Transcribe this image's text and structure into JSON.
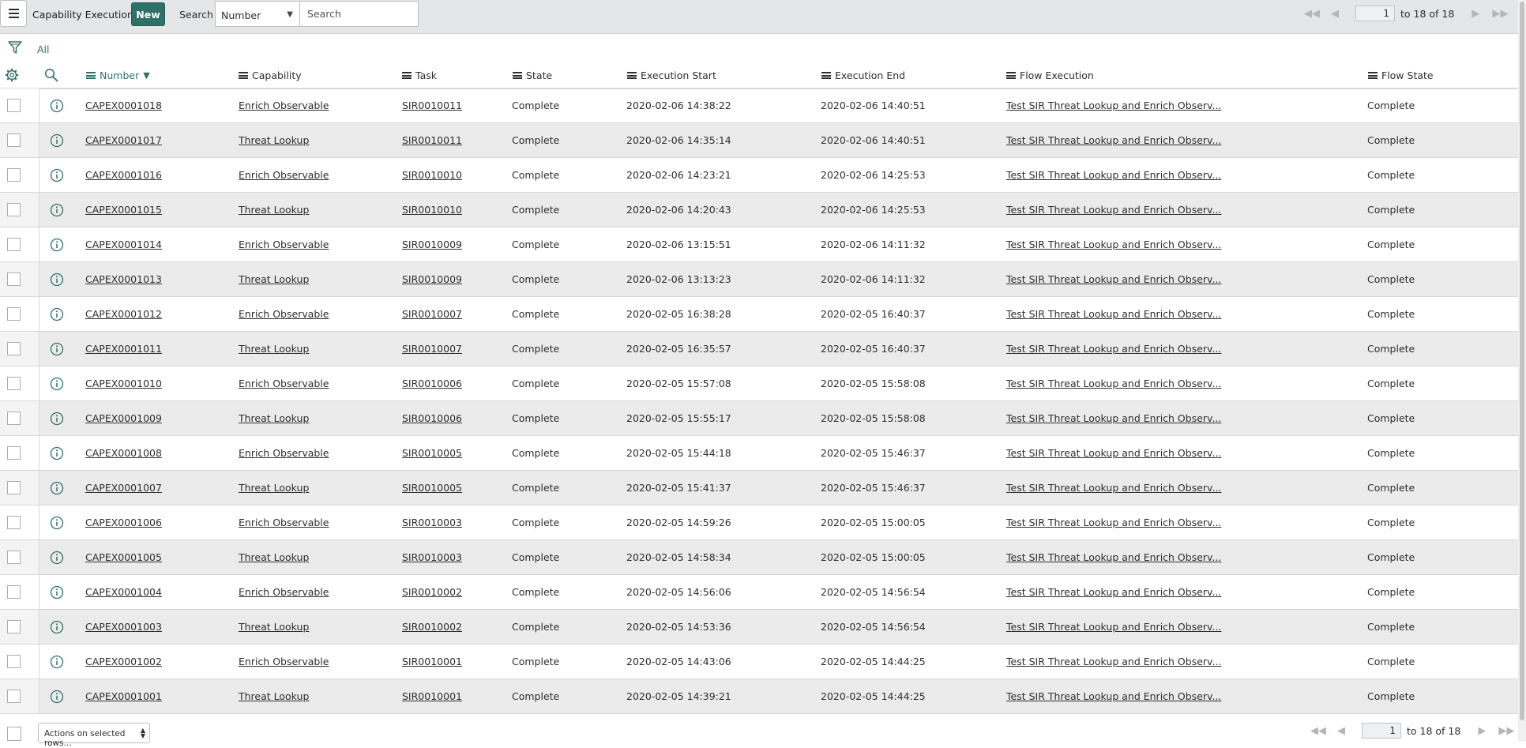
{
  "header": {
    "title": "Capability Executions",
    "new_label": "New",
    "search_label": "Search",
    "search_field_selected": "Number",
    "search_placeholder": "Search",
    "page_number": "1",
    "page_count_text": "to 18 of 18"
  },
  "filter": {
    "breadcrumb_all": "All"
  },
  "columns": [
    "Number",
    "Capability",
    "Task",
    "State",
    "Execution Start",
    "Execution End",
    "Flow Execution",
    "Flow State"
  ],
  "rows": [
    {
      "number": "CAPEX0001018",
      "capability": "Enrich Observable",
      "task": "SIR0010011",
      "state": "Complete",
      "start": "2020-02-06 14:38:22",
      "end": "2020-02-06 14:40:51",
      "flow": "Test SIR Threat Lookup and Enrich Observ...",
      "flow_state": "Complete"
    },
    {
      "number": "CAPEX0001017",
      "capability": "Threat Lookup",
      "task": "SIR0010011",
      "state": "Complete",
      "start": "2020-02-06 14:35:14",
      "end": "2020-02-06 14:40:51",
      "flow": "Test SIR Threat Lookup and Enrich Observ...",
      "flow_state": "Complete"
    },
    {
      "number": "CAPEX0001016",
      "capability": "Enrich Observable",
      "task": "SIR0010010",
      "state": "Complete",
      "start": "2020-02-06 14:23:21",
      "end": "2020-02-06 14:25:53",
      "flow": "Test SIR Threat Lookup and Enrich Observ...",
      "flow_state": "Complete"
    },
    {
      "number": "CAPEX0001015",
      "capability": "Threat Lookup",
      "task": "SIR0010010",
      "state": "Complete",
      "start": "2020-02-06 14:20:43",
      "end": "2020-02-06 14:25:53",
      "flow": "Test SIR Threat Lookup and Enrich Observ...",
      "flow_state": "Complete"
    },
    {
      "number": "CAPEX0001014",
      "capability": "Enrich Observable",
      "task": "SIR0010009",
      "state": "Complete",
      "start": "2020-02-06 13:15:51",
      "end": "2020-02-06 14:11:32",
      "flow": "Test SIR Threat Lookup and Enrich Observ...",
      "flow_state": "Complete"
    },
    {
      "number": "CAPEX0001013",
      "capability": "Threat Lookup",
      "task": "SIR0010009",
      "state": "Complete",
      "start": "2020-02-06 13:13:23",
      "end": "2020-02-06 14:11:32",
      "flow": "Test SIR Threat Lookup and Enrich Observ...",
      "flow_state": "Complete"
    },
    {
      "number": "CAPEX0001012",
      "capability": "Enrich Observable",
      "task": "SIR0010007",
      "state": "Complete",
      "start": "2020-02-05 16:38:28",
      "end": "2020-02-05 16:40:37",
      "flow": "Test SIR Threat Lookup and Enrich Observ...",
      "flow_state": "Complete"
    },
    {
      "number": "CAPEX0001011",
      "capability": "Threat Lookup",
      "task": "SIR0010007",
      "state": "Complete",
      "start": "2020-02-05 16:35:57",
      "end": "2020-02-05 16:40:37",
      "flow": "Test SIR Threat Lookup and Enrich Observ...",
      "flow_state": "Complete"
    },
    {
      "number": "CAPEX0001010",
      "capability": "Enrich Observable",
      "task": "SIR0010006",
      "state": "Complete",
      "start": "2020-02-05 15:57:08",
      "end": "2020-02-05 15:58:08",
      "flow": "Test SIR Threat Lookup and Enrich Observ...",
      "flow_state": "Complete"
    },
    {
      "number": "CAPEX0001009",
      "capability": "Threat Lookup",
      "task": "SIR0010006",
      "state": "Complete",
      "start": "2020-02-05 15:55:17",
      "end": "2020-02-05 15:58:08",
      "flow": "Test SIR Threat Lookup and Enrich Observ...",
      "flow_state": "Complete"
    },
    {
      "number": "CAPEX0001008",
      "capability": "Enrich Observable",
      "task": "SIR0010005",
      "state": "Complete",
      "start": "2020-02-05 15:44:18",
      "end": "2020-02-05 15:46:37",
      "flow": "Test SIR Threat Lookup and Enrich Observ...",
      "flow_state": "Complete"
    },
    {
      "number": "CAPEX0001007",
      "capability": "Threat Lookup",
      "task": "SIR0010005",
      "state": "Complete",
      "start": "2020-02-05 15:41:37",
      "end": "2020-02-05 15:46:37",
      "flow": "Test SIR Threat Lookup and Enrich Observ...",
      "flow_state": "Complete"
    },
    {
      "number": "CAPEX0001006",
      "capability": "Enrich Observable",
      "task": "SIR0010003",
      "state": "Complete",
      "start": "2020-02-05 14:59:26",
      "end": "2020-02-05 15:00:05",
      "flow": "Test SIR Threat Lookup and Enrich Observ...",
      "flow_state": "Complete"
    },
    {
      "number": "CAPEX0001005",
      "capability": "Threat Lookup",
      "task": "SIR0010003",
      "state": "Complete",
      "start": "2020-02-05 14:58:34",
      "end": "2020-02-05 15:00:05",
      "flow": "Test SIR Threat Lookup and Enrich Observ...",
      "flow_state": "Complete"
    },
    {
      "number": "CAPEX0001004",
      "capability": "Enrich Observable",
      "task": "SIR0010002",
      "state": "Complete",
      "start": "2020-02-05 14:56:06",
      "end": "2020-02-05 14:56:54",
      "flow": "Test SIR Threat Lookup and Enrich Observ...",
      "flow_state": "Complete"
    },
    {
      "number": "CAPEX0001003",
      "capability": "Threat Lookup",
      "task": "SIR0010002",
      "state": "Complete",
      "start": "2020-02-05 14:53:36",
      "end": "2020-02-05 14:56:54",
      "flow": "Test SIR Threat Lookup and Enrich Observ...",
      "flow_state": "Complete"
    },
    {
      "number": "CAPEX0001002",
      "capability": "Enrich Observable",
      "task": "SIR0010001",
      "state": "Complete",
      "start": "2020-02-05 14:43:06",
      "end": "2020-02-05 14:44:25",
      "flow": "Test SIR Threat Lookup and Enrich Observ...",
      "flow_state": "Complete"
    },
    {
      "number": "CAPEX0001001",
      "capability": "Threat Lookup",
      "task": "SIR0010001",
      "state": "Complete",
      "start": "2020-02-05 14:39:21",
      "end": "2020-02-05 14:44:25",
      "flow": "Test SIR Threat Lookup and Enrich Observ...",
      "flow_state": "Complete"
    }
  ],
  "footer": {
    "actions_label": "Actions on selected rows...",
    "page_number": "1",
    "page_count_text": "to 18 of 18"
  },
  "colors": {
    "accent": "#2e7167",
    "header_bg": "#e4e6e7",
    "row_alt": "#ebebeb"
  },
  "icons": [
    "menu-icon",
    "filter-icon",
    "gear-icon",
    "search-icon",
    "sort-desc-icon",
    "info-icon",
    "first-page-icon",
    "prev-page-icon",
    "next-page-icon",
    "last-page-icon"
  ]
}
